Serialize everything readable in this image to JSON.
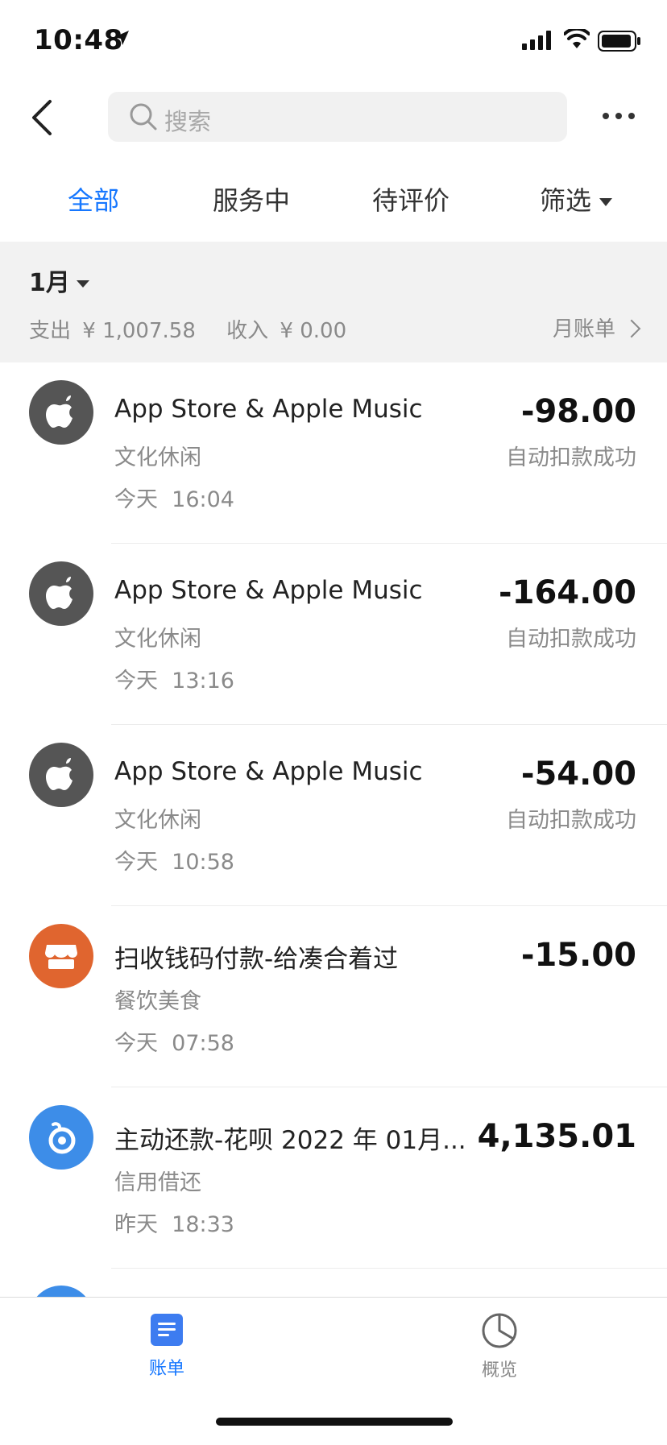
{
  "status_bar": {
    "time": "10:48"
  },
  "header": {
    "search_placeholder": "搜索"
  },
  "tabs": [
    {
      "label": "全部",
      "active": true
    },
    {
      "label": "服务中",
      "active": false
    },
    {
      "label": "待评价",
      "active": false
    },
    {
      "label": "筛选",
      "active": false
    }
  ],
  "month": {
    "label": "1月",
    "expense_label": "支出",
    "expense_value": "¥ 1,007.58",
    "income_label": "收入",
    "income_value": "¥ 0.00",
    "bill_link": "月账单"
  },
  "transactions": [
    {
      "title": "App Store & Apple Music",
      "category": "文化休闲",
      "day": "今天",
      "time": "16:04",
      "amount": "-98.00",
      "status": "自动扣款成功",
      "icon": "apple-icon",
      "icon_color": "#555555"
    },
    {
      "title": "App Store & Apple Music",
      "category": "文化休闲",
      "day": "今天",
      "time": "13:16",
      "amount": "-164.00",
      "status": "自动扣款成功",
      "icon": "apple-icon",
      "icon_color": "#555555"
    },
    {
      "title": "App Store & Apple Music",
      "category": "文化休闲",
      "day": "今天",
      "time": "10:58",
      "amount": "-54.00",
      "status": "自动扣款成功",
      "icon": "apple-icon",
      "icon_color": "#555555"
    },
    {
      "title": "扫收钱码付款-给凑合着过",
      "category": "餐饮美食",
      "day": "今天",
      "time": "07:58",
      "amount": "-15.00",
      "status": "",
      "icon": "store-icon",
      "icon_color": "#e0652f"
    },
    {
      "title": "主动还款-花呗 2022 年 01月...",
      "category": "信用借还",
      "day": "昨天",
      "time": "18:33",
      "amount": "4,135.01",
      "status": "",
      "icon": "huabei-icon",
      "icon_color": "#3d8de8"
    }
  ],
  "bottom_nav": [
    {
      "label": "账单",
      "icon": "bill-icon",
      "active": true
    },
    {
      "label": "概览",
      "icon": "pie-chart-icon",
      "active": false
    }
  ],
  "colors": {
    "accent": "#1677ff",
    "section_bg": "#f2f2f2"
  }
}
